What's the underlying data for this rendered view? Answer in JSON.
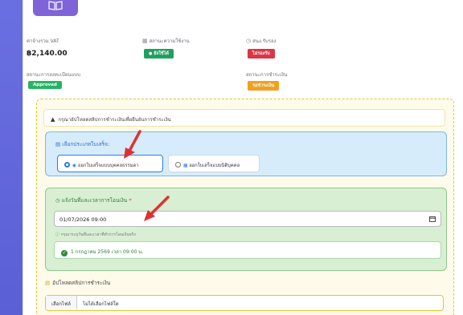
{
  "header": {
    "vat_label": "ค่าจ้างรวม VAT",
    "vat_value": "฿2,140.00",
    "status_label": "สถานะความใช้งาน",
    "status_badge": "ยังใช้ได้",
    "docs_label": "สนง.รับรอง",
    "docs_badge": "ไม่รองรับ",
    "reg_label": "สถานะการลงทะเบียนแบบ",
    "reg_badge": "Approved",
    "pay_label": "สถานะการชำระเงิน",
    "pay_badge": "รอชำระเงิน"
  },
  "warning": {
    "text": "กรุณาอัปโหลดสลิปการชำระเงินเพื่อยืนยันการชำระเงิน"
  },
  "receipt_type": {
    "title": "เลือกประเภทใบเสร็จ:",
    "option1": "ออกใบเสร็จแบบบุคคลธรรมดา",
    "option2": "ออกใบเสร็จแบบนิติบุคคล",
    "selected": "option1"
  },
  "transfer": {
    "title": "แจ้งวันที่และเวลาการโอนเงิน",
    "required_mark": "*",
    "value": "01/07/2026 09:00",
    "hint": "กรุณาระบุวันที่และเวลาที่ทำการโอนเงินจริง",
    "confirm": "1 กรกฎาคม 2569 เวลา 09:00 น."
  },
  "upload": {
    "title": "อัปโหลดสลิปการชำระเงิน",
    "button": "เลือกไฟล์",
    "no_file": "ไม่ได้เลือกไฟล์ใด"
  },
  "colors": {
    "accent_purple": "#7e64d6",
    "panel_border": "#f0c030",
    "blue_panel": "#d6ecfb",
    "green_panel": "#d8efd3",
    "annotation_arrow": "#e03030"
  }
}
